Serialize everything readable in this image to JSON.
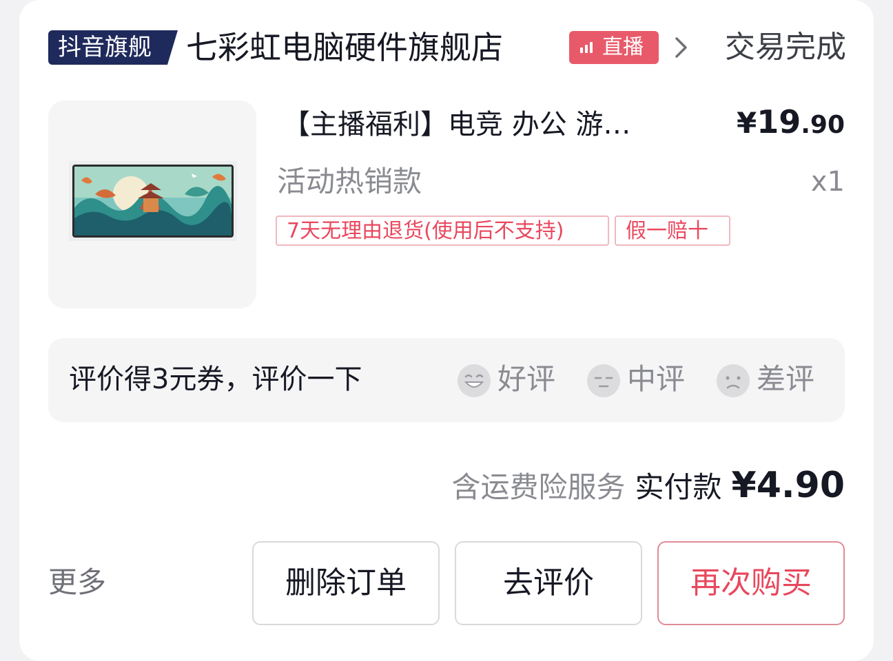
{
  "header": {
    "platform_badge": "抖音旗舰",
    "shop_name": "七彩虹电脑硬件旗舰店",
    "live_label": "直播",
    "order_status": "交易完成"
  },
  "product": {
    "title": "【主播福利】电竞 办公 游…",
    "price_symbol": "¥",
    "price_integer": "19",
    "price_decimal": ".90",
    "sku": "活动热销款",
    "quantity": "x1",
    "tags": [
      "7天无理由退货(使用后不支持)",
      "假一赔十"
    ]
  },
  "review": {
    "prompt": "评价得3元券，评价一下",
    "options": [
      {
        "label": "好评",
        "icon": "happy-face-icon"
      },
      {
        "label": "中评",
        "icon": "neutral-face-icon"
      },
      {
        "label": "差评",
        "icon": "sad-face-icon"
      }
    ]
  },
  "payment": {
    "insurance_note": "含运费险服务",
    "paid_label": "实付款",
    "paid_value": "¥4.90"
  },
  "actions": {
    "more": "更多",
    "delete": "删除订单",
    "review": "去评价",
    "rebuy": "再次购买"
  },
  "colors": {
    "badge_navy": "#1f2a5c",
    "live_red": "#e85a6a",
    "tag_red": "#e8485e",
    "text_dark": "#161823",
    "text_gray": "#8a8b91"
  }
}
